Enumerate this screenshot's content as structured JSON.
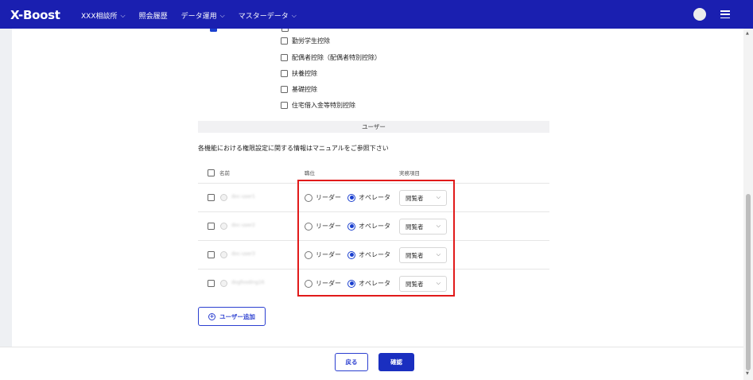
{
  "header": {
    "logo": "X-Boost",
    "nav": [
      {
        "label": "XXX相談所",
        "has_dropdown": true
      },
      {
        "label": "照会履歴",
        "has_dropdown": false
      },
      {
        "label": "データ運用",
        "has_dropdown": true
      },
      {
        "label": "マスターデータ",
        "has_dropdown": true
      }
    ],
    "chevron": "⌵"
  },
  "deductions": [
    {
      "label": "勤労学生控除",
      "checked": false
    },
    {
      "label": "配偶者控除（配偶者特別控除）",
      "checked": false
    },
    {
      "label": "扶養控除",
      "checked": false
    },
    {
      "label": "基礎控除",
      "checked": false
    },
    {
      "label": "住宅借入金等特別控除",
      "checked": false
    }
  ],
  "users_section": {
    "title": "ユーザー",
    "notice": "各機能における権限設定に関する情報はマニュアルをご参照下さい",
    "columns": {
      "name": "名前",
      "position": "職位",
      "item": "実務項目"
    },
    "rows": [
      {
        "name": "doc-user1",
        "role_leader": "リーダー",
        "role_operator": "オペレータ",
        "selected": "operator",
        "item": "閲覧者"
      },
      {
        "name": "doc-user2",
        "role_leader": "リーダー",
        "role_operator": "オペレータ",
        "selected": "operator",
        "item": "閲覧者"
      },
      {
        "name": "doc-user3",
        "role_leader": "リーダー",
        "role_operator": "オペレータ",
        "selected": "operator",
        "item": "閲覧者"
      },
      {
        "name": "dogfooding16",
        "role_leader": "リーダー",
        "role_operator": "オペレータ",
        "selected": "operator",
        "item": "閲覧者"
      }
    ],
    "add_button": "ユーザー追加"
  },
  "footer": {
    "back": "戻る",
    "confirm": "確認"
  },
  "colors": {
    "header_bg": "#1a1fb0",
    "accent": "#2b3fd0",
    "highlight": "#e11a1a"
  }
}
